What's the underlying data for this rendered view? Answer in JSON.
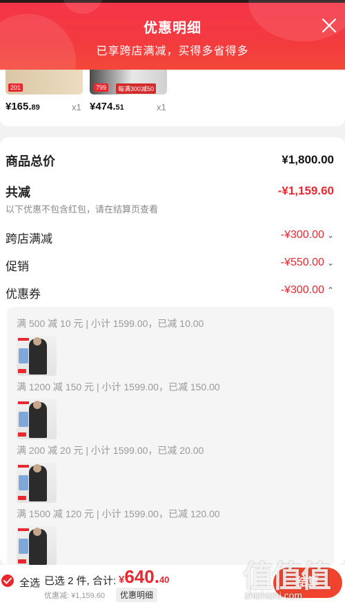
{
  "header": {
    "title": "优惠明细",
    "subtitle": "已享跨店满减，买得多省得多",
    "close_icon": "close-icon"
  },
  "products": [
    {
      "price_int": "¥165.",
      "price_dec": "89",
      "qty": "x1",
      "tag": "201",
      "tag2": ""
    },
    {
      "price_int": "¥474.",
      "price_dec": "51",
      "qty": "x1",
      "tag": "799",
      "tag2": "每满300减50"
    }
  ],
  "summary": {
    "total_label": "商品总价",
    "total_value": "¥1,800.00",
    "reduce_label": "共减",
    "reduce_value": "-¥1,159.60",
    "note": "以下优惠不包含红包，请在结算页查看",
    "rows": [
      {
        "label": "跨店满减",
        "value": "-¥300.00",
        "chevron": "⌄"
      },
      {
        "label": "促销",
        "value": "-¥550.00",
        "chevron": "⌄"
      },
      {
        "label": "优惠券",
        "value": "-¥300.00",
        "chevron": "⌃"
      }
    ]
  },
  "coupons": [
    "满 500 减 10 元 | 小计 1599.00，已减 10.00",
    "满 1200 减 150 元 | 小计 1599.00，已减 150.00",
    "满 200 减 20 元 | 小计 1599.00，已减 20.00",
    "满 1500 减 120 元 | 小计 1599.00，已减 120.00"
  ],
  "bottom": {
    "select_all": "全选",
    "selected_text": "已选 2 件, 合计:",
    "total_currency": "¥",
    "total_int": "640.",
    "total_dec": "40",
    "discount_text": "优惠减: ¥1,159.60",
    "detail_button": "优惠明细",
    "checkout_label": "结算"
  },
  "watermark": {
    "glyphs": "值值值",
    "site": "zhizhizhi.com"
  },
  "colors": {
    "accent": "#e8272f",
    "header": "#f33a3f"
  }
}
